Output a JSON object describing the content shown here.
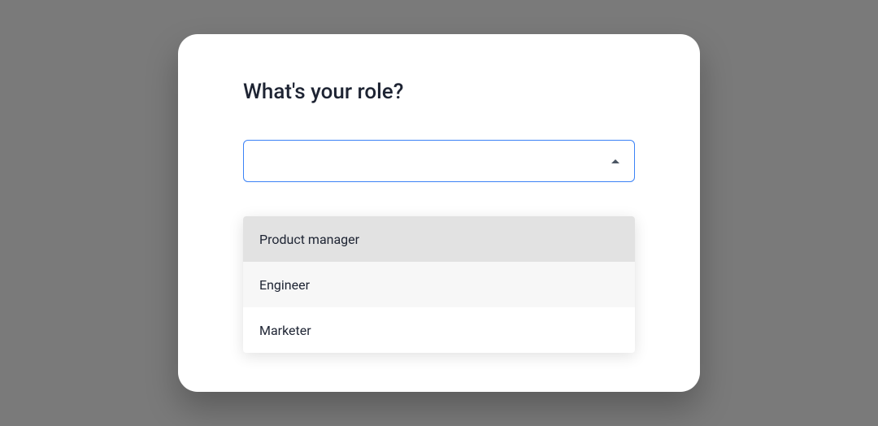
{
  "prompt": {
    "title": "What's your role?"
  },
  "select": {
    "value": "",
    "options": [
      {
        "label": "Product manager"
      },
      {
        "label": "Engineer"
      },
      {
        "label": "Marketer"
      }
    ]
  }
}
